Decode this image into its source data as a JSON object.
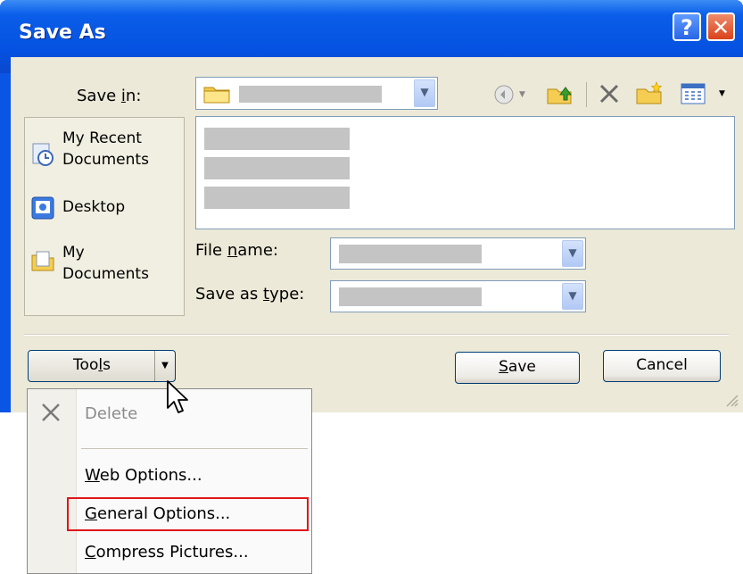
{
  "window": {
    "title": "Save As"
  },
  "titlebar": {
    "help_label": "?",
    "close_label": "✕"
  },
  "save_in": {
    "label_pre": "Save ",
    "label_key": "i",
    "label_post": "n:"
  },
  "toolbar_icons": [
    "back-icon",
    "up-folder-icon",
    "delete-icon",
    "new-folder-icon",
    "views-icon"
  ],
  "places": [
    {
      "name": "recent",
      "line1": "My Recent",
      "line2": "Documents",
      "icon": "recent-documents-icon"
    },
    {
      "name": "desktop",
      "line1": "Desktop",
      "line2": "",
      "icon": "desktop-icon"
    },
    {
      "name": "mydocs",
      "line1": "My",
      "line2": "Documents",
      "icon": "my-documents-icon"
    }
  ],
  "file_name": {
    "label_pre": "File ",
    "label_key": "n",
    "label_post": "ame:"
  },
  "save_as_type": {
    "label_pre": "Save as ",
    "label_key": "t",
    "label_post": "ype:"
  },
  "buttons": {
    "tools_pre": "Too",
    "tools_key": "l",
    "tools_post": "s",
    "save_key": "S",
    "save_post": "ave",
    "cancel": "Cancel"
  },
  "tools_menu": {
    "delete": "Delete",
    "web_options_key": "W",
    "web_options_post": "eb Options...",
    "general_options_key": "G",
    "general_options_post": "eneral Options...",
    "compress_key": "C",
    "compress_post": "ompress Pictures..."
  },
  "colors": {
    "titlebar": "#0551e1",
    "dialog_bg": "#ece9d8",
    "highlight_border": "#e0161a"
  }
}
